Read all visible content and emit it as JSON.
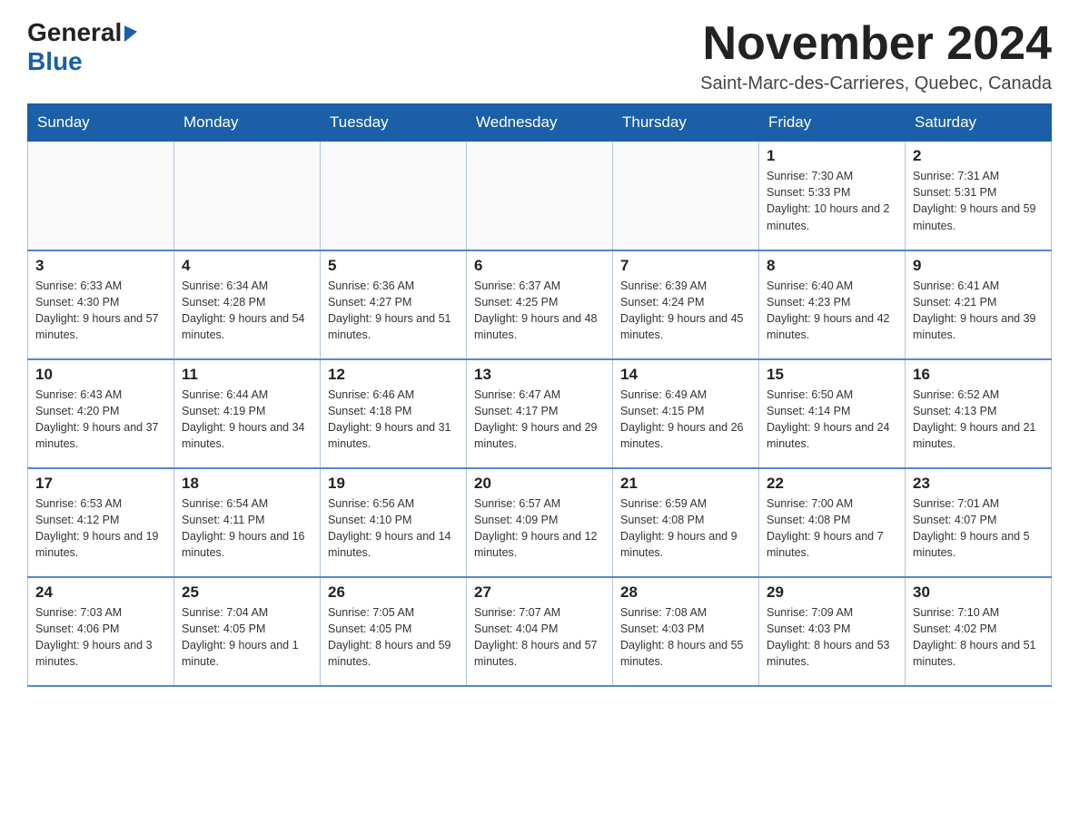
{
  "header": {
    "logo_general": "General",
    "logo_blue": "Blue",
    "main_title": "November 2024",
    "subtitle": "Saint-Marc-des-Carrieres, Quebec, Canada"
  },
  "calendar": {
    "weekdays": [
      "Sunday",
      "Monday",
      "Tuesday",
      "Wednesday",
      "Thursday",
      "Friday",
      "Saturday"
    ],
    "weeks": [
      [
        {
          "day": "",
          "info": ""
        },
        {
          "day": "",
          "info": ""
        },
        {
          "day": "",
          "info": ""
        },
        {
          "day": "",
          "info": ""
        },
        {
          "day": "",
          "info": ""
        },
        {
          "day": "1",
          "info": "Sunrise: 7:30 AM\nSunset: 5:33 PM\nDaylight: 10 hours and 2 minutes."
        },
        {
          "day": "2",
          "info": "Sunrise: 7:31 AM\nSunset: 5:31 PM\nDaylight: 9 hours and 59 minutes."
        }
      ],
      [
        {
          "day": "3",
          "info": "Sunrise: 6:33 AM\nSunset: 4:30 PM\nDaylight: 9 hours and 57 minutes."
        },
        {
          "day": "4",
          "info": "Sunrise: 6:34 AM\nSunset: 4:28 PM\nDaylight: 9 hours and 54 minutes."
        },
        {
          "day": "5",
          "info": "Sunrise: 6:36 AM\nSunset: 4:27 PM\nDaylight: 9 hours and 51 minutes."
        },
        {
          "day": "6",
          "info": "Sunrise: 6:37 AM\nSunset: 4:25 PM\nDaylight: 9 hours and 48 minutes."
        },
        {
          "day": "7",
          "info": "Sunrise: 6:39 AM\nSunset: 4:24 PM\nDaylight: 9 hours and 45 minutes."
        },
        {
          "day": "8",
          "info": "Sunrise: 6:40 AM\nSunset: 4:23 PM\nDaylight: 9 hours and 42 minutes."
        },
        {
          "day": "9",
          "info": "Sunrise: 6:41 AM\nSunset: 4:21 PM\nDaylight: 9 hours and 39 minutes."
        }
      ],
      [
        {
          "day": "10",
          "info": "Sunrise: 6:43 AM\nSunset: 4:20 PM\nDaylight: 9 hours and 37 minutes."
        },
        {
          "day": "11",
          "info": "Sunrise: 6:44 AM\nSunset: 4:19 PM\nDaylight: 9 hours and 34 minutes."
        },
        {
          "day": "12",
          "info": "Sunrise: 6:46 AM\nSunset: 4:18 PM\nDaylight: 9 hours and 31 minutes."
        },
        {
          "day": "13",
          "info": "Sunrise: 6:47 AM\nSunset: 4:17 PM\nDaylight: 9 hours and 29 minutes."
        },
        {
          "day": "14",
          "info": "Sunrise: 6:49 AM\nSunset: 4:15 PM\nDaylight: 9 hours and 26 minutes."
        },
        {
          "day": "15",
          "info": "Sunrise: 6:50 AM\nSunset: 4:14 PM\nDaylight: 9 hours and 24 minutes."
        },
        {
          "day": "16",
          "info": "Sunrise: 6:52 AM\nSunset: 4:13 PM\nDaylight: 9 hours and 21 minutes."
        }
      ],
      [
        {
          "day": "17",
          "info": "Sunrise: 6:53 AM\nSunset: 4:12 PM\nDaylight: 9 hours and 19 minutes."
        },
        {
          "day": "18",
          "info": "Sunrise: 6:54 AM\nSunset: 4:11 PM\nDaylight: 9 hours and 16 minutes."
        },
        {
          "day": "19",
          "info": "Sunrise: 6:56 AM\nSunset: 4:10 PM\nDaylight: 9 hours and 14 minutes."
        },
        {
          "day": "20",
          "info": "Sunrise: 6:57 AM\nSunset: 4:09 PM\nDaylight: 9 hours and 12 minutes."
        },
        {
          "day": "21",
          "info": "Sunrise: 6:59 AM\nSunset: 4:08 PM\nDaylight: 9 hours and 9 minutes."
        },
        {
          "day": "22",
          "info": "Sunrise: 7:00 AM\nSunset: 4:08 PM\nDaylight: 9 hours and 7 minutes."
        },
        {
          "day": "23",
          "info": "Sunrise: 7:01 AM\nSunset: 4:07 PM\nDaylight: 9 hours and 5 minutes."
        }
      ],
      [
        {
          "day": "24",
          "info": "Sunrise: 7:03 AM\nSunset: 4:06 PM\nDaylight: 9 hours and 3 minutes."
        },
        {
          "day": "25",
          "info": "Sunrise: 7:04 AM\nSunset: 4:05 PM\nDaylight: 9 hours and 1 minute."
        },
        {
          "day": "26",
          "info": "Sunrise: 7:05 AM\nSunset: 4:05 PM\nDaylight: 8 hours and 59 minutes."
        },
        {
          "day": "27",
          "info": "Sunrise: 7:07 AM\nSunset: 4:04 PM\nDaylight: 8 hours and 57 minutes."
        },
        {
          "day": "28",
          "info": "Sunrise: 7:08 AM\nSunset: 4:03 PM\nDaylight: 8 hours and 55 minutes."
        },
        {
          "day": "29",
          "info": "Sunrise: 7:09 AM\nSunset: 4:03 PM\nDaylight: 8 hours and 53 minutes."
        },
        {
          "day": "30",
          "info": "Sunrise: 7:10 AM\nSunset: 4:02 PM\nDaylight: 8 hours and 51 minutes."
        }
      ]
    ]
  }
}
